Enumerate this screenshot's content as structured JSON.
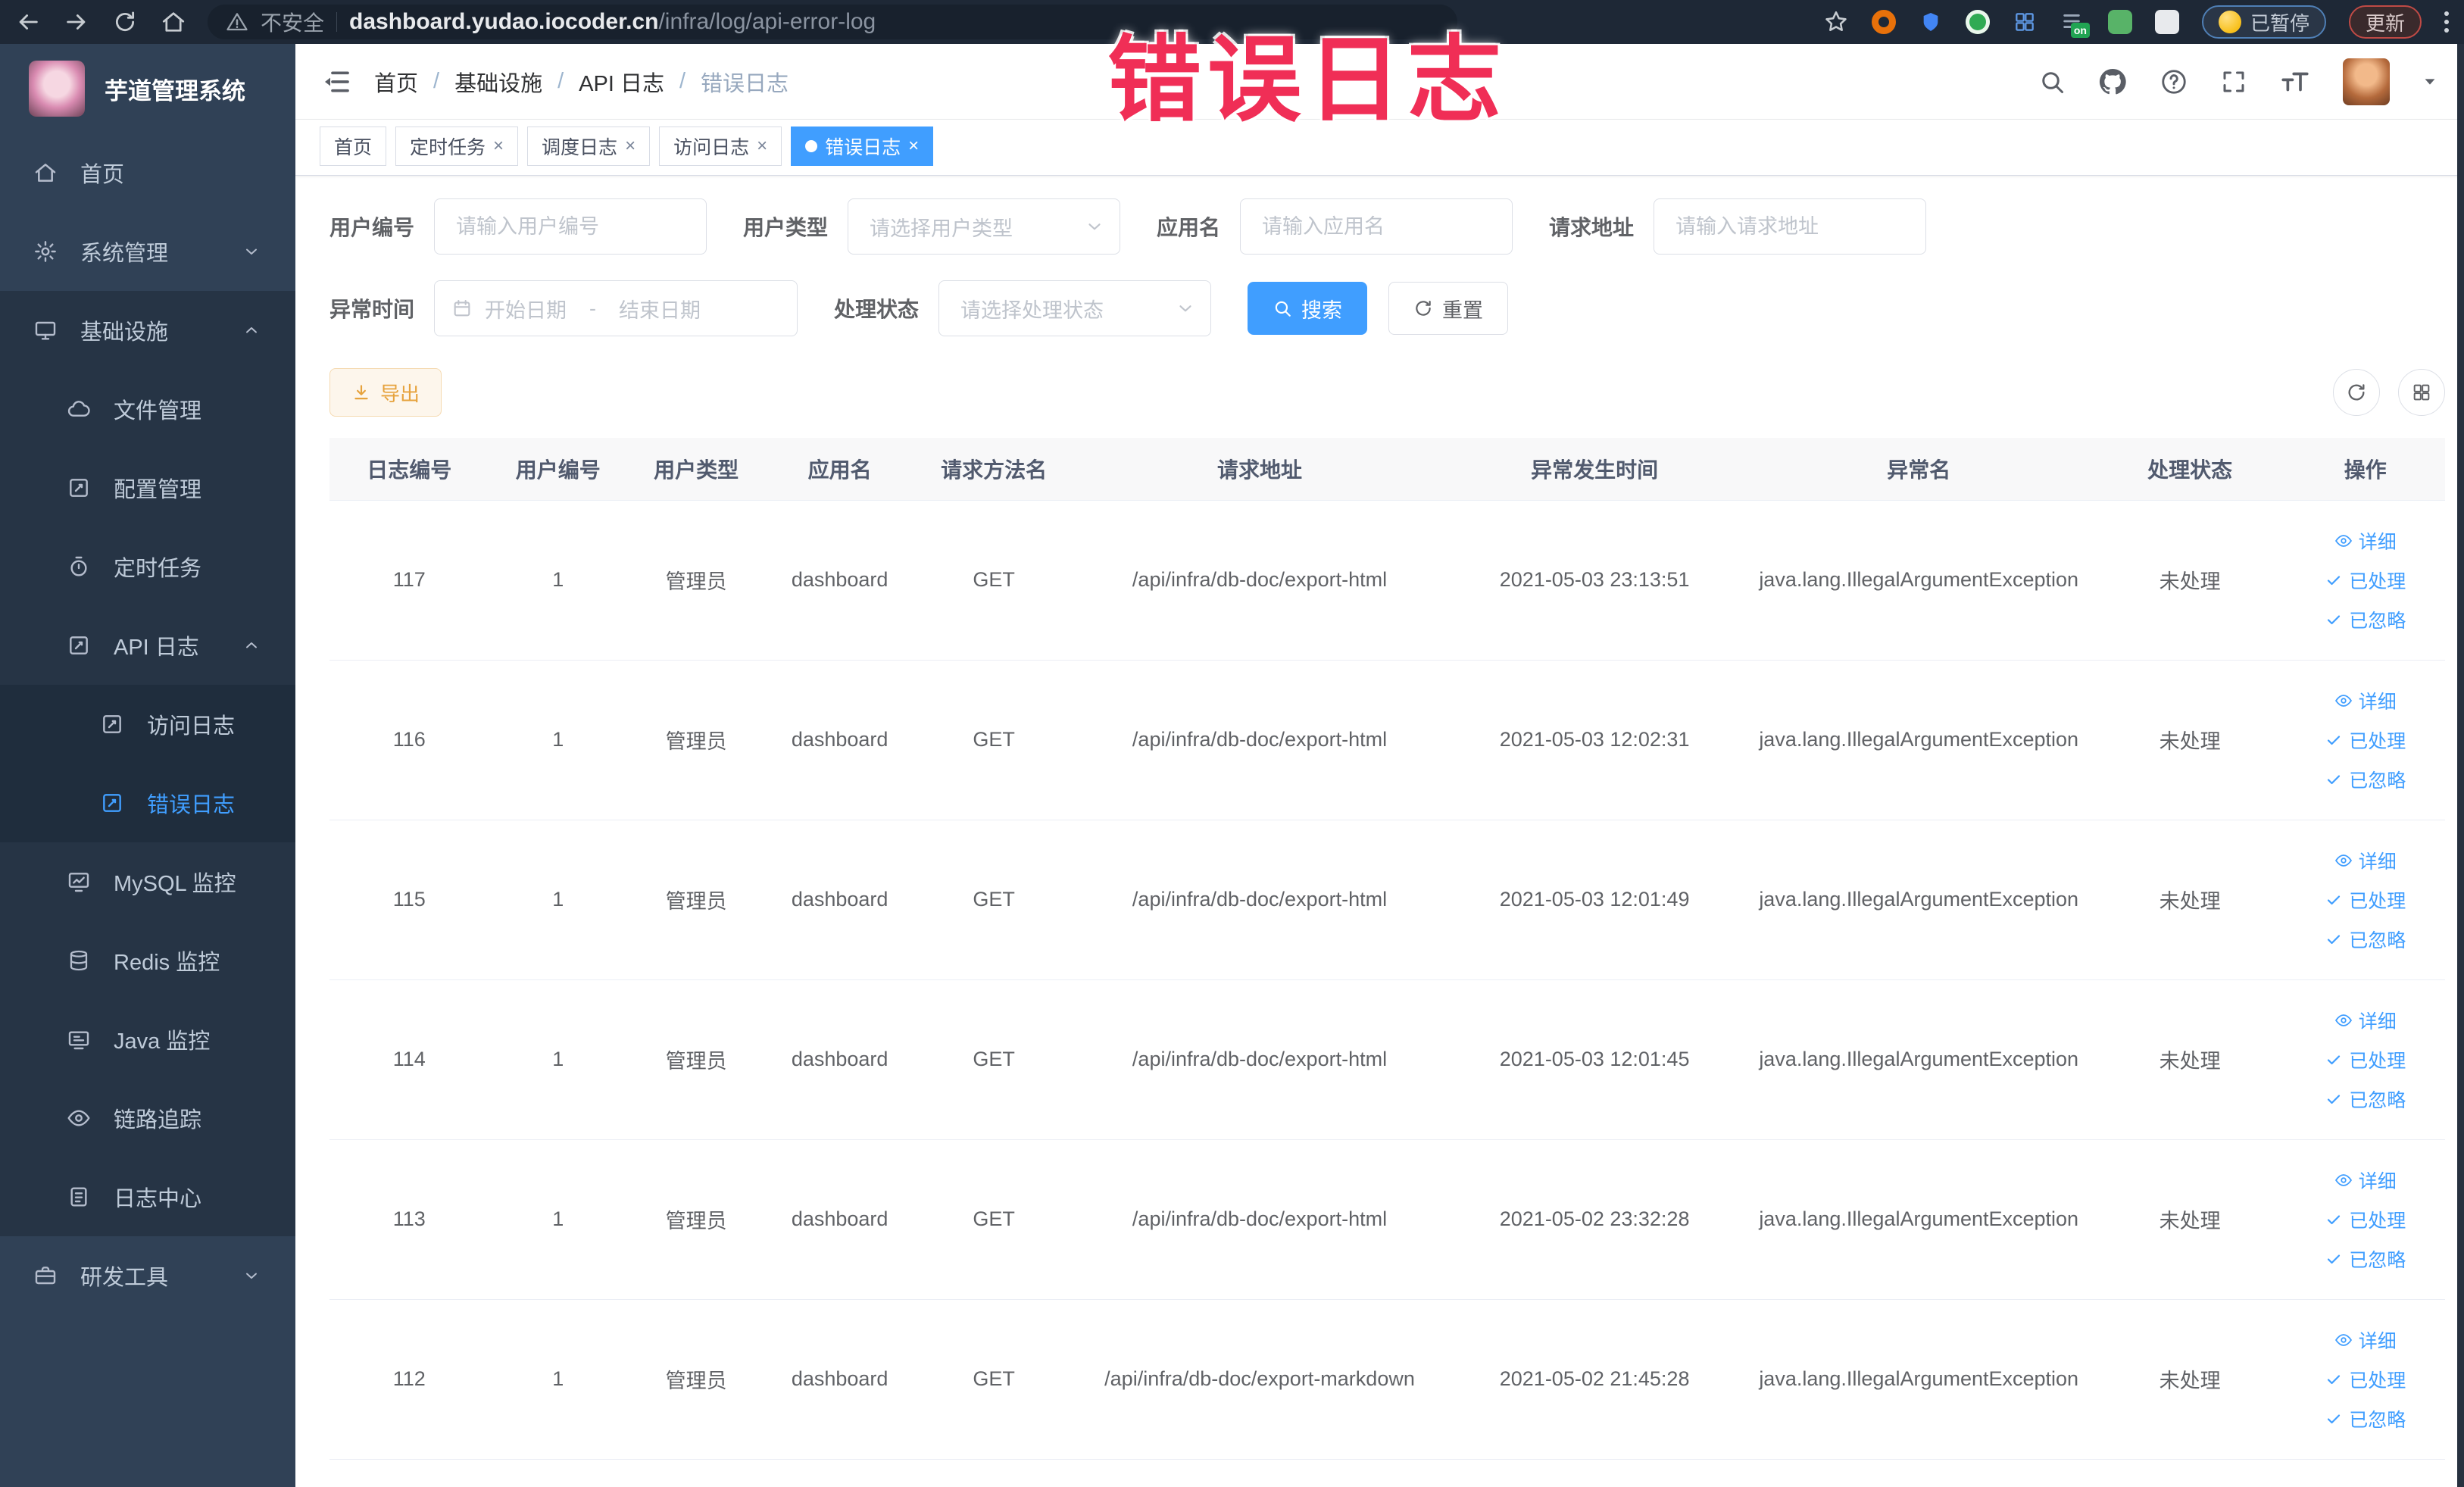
{
  "colors": {
    "primary": "#409eff",
    "warning": "#e6a23c",
    "sidebar_bg": "#304156",
    "annotation_red": "#f02e56",
    "active_tab_bg": "#409eff"
  },
  "annotation": {
    "text": "错误日志"
  },
  "icons": {
    "close": "×",
    "on_label": "on"
  },
  "browser": {
    "security_label": "不安全",
    "url_host": "dashboard.yudao.iocoder.cn",
    "url_path": "/infra/log/api-error-log",
    "paused_badge": "已暂停",
    "update_button": "更新"
  },
  "sidebar": {
    "title": "芋道管理系统",
    "items": [
      {
        "label": "首页"
      },
      {
        "label": "系统管理"
      },
      {
        "label": "基础设施"
      },
      {
        "label": "文件管理"
      },
      {
        "label": "配置管理"
      },
      {
        "label": "定时任务"
      },
      {
        "label": "API 日志"
      },
      {
        "label": "访问日志"
      },
      {
        "label": "错误日志"
      },
      {
        "label": "MySQL 监控"
      },
      {
        "label": "Redis 监控"
      },
      {
        "label": "Java 监控"
      },
      {
        "label": "链路追踪"
      },
      {
        "label": "日志中心"
      },
      {
        "label": "研发工具"
      }
    ]
  },
  "breadcrumb": {
    "items": [
      "首页",
      "基础设施",
      "API 日志",
      "错误日志"
    ],
    "separator": "/"
  },
  "tabs": [
    {
      "label": "首页",
      "closable": false,
      "active": false
    },
    {
      "label": "定时任务",
      "closable": true,
      "active": false
    },
    {
      "label": "调度日志",
      "closable": true,
      "active": false
    },
    {
      "label": "访问日志",
      "closable": true,
      "active": false
    },
    {
      "label": "错误日志",
      "closable": true,
      "active": true
    }
  ],
  "filters": {
    "user_id": {
      "label": "用户编号",
      "placeholder": "请输入用户编号"
    },
    "user_type": {
      "label": "用户类型",
      "placeholder": "请选择用户类型"
    },
    "app_name": {
      "label": "应用名",
      "placeholder": "请输入应用名"
    },
    "request_url": {
      "label": "请求地址",
      "placeholder": "请输入请求地址"
    },
    "exception_time": {
      "label": "异常时间",
      "start_placeholder": "开始日期",
      "separator": "-",
      "end_placeholder": "结束日期"
    },
    "process_status": {
      "label": "处理状态",
      "placeholder": "请选择处理状态"
    },
    "search_button": "搜索",
    "reset_button": "重置"
  },
  "toolbar": {
    "export_label": "导出"
  },
  "table": {
    "columns": [
      "日志编号",
      "用户编号",
      "用户类型",
      "应用名",
      "请求方法名",
      "请求地址",
      "异常发生时间",
      "异常名",
      "处理状态",
      "操作"
    ],
    "actions": {
      "detail": "详细",
      "processed": "已处理",
      "ignored": "已忽略"
    },
    "rows": [
      {
        "id": "117",
        "user_id": "1",
        "user_type": "管理员",
        "app": "dashboard",
        "method": "GET",
        "url": "/api/infra/db-doc/export-html",
        "time": "2021-05-03 23:13:51",
        "exception": "java.lang.IllegalArgumentException",
        "status": "未处理"
      },
      {
        "id": "116",
        "user_id": "1",
        "user_type": "管理员",
        "app": "dashboard",
        "method": "GET",
        "url": "/api/infra/db-doc/export-html",
        "time": "2021-05-03 12:02:31",
        "exception": "java.lang.IllegalArgumentException",
        "status": "未处理"
      },
      {
        "id": "115",
        "user_id": "1",
        "user_type": "管理员",
        "app": "dashboard",
        "method": "GET",
        "url": "/api/infra/db-doc/export-html",
        "time": "2021-05-03 12:01:49",
        "exception": "java.lang.IllegalArgumentException",
        "status": "未处理"
      },
      {
        "id": "114",
        "user_id": "1",
        "user_type": "管理员",
        "app": "dashboard",
        "method": "GET",
        "url": "/api/infra/db-doc/export-html",
        "time": "2021-05-03 12:01:45",
        "exception": "java.lang.IllegalArgumentException",
        "status": "未处理"
      },
      {
        "id": "113",
        "user_id": "1",
        "user_type": "管理员",
        "app": "dashboard",
        "method": "GET",
        "url": "/api/infra/db-doc/export-html",
        "time": "2021-05-02 23:32:28",
        "exception": "java.lang.IllegalArgumentException",
        "status": "未处理"
      },
      {
        "id": "112",
        "user_id": "1",
        "user_type": "管理员",
        "app": "dashboard",
        "method": "GET",
        "url": "/api/infra/db-doc/export-markdown",
        "time": "2021-05-02 21:45:28",
        "exception": "java.lang.IllegalArgumentException",
        "status": "未处理"
      }
    ]
  }
}
